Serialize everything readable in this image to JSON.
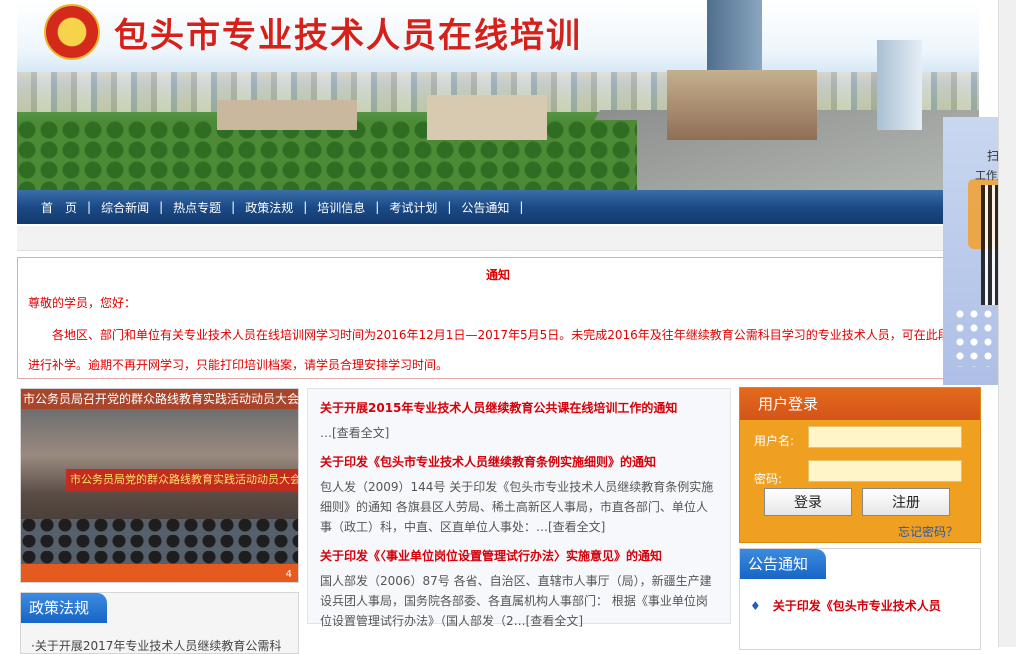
{
  "site": {
    "title": "包头市专业技术人员在线培训"
  },
  "nav": {
    "items": [
      "首　页",
      "综合新闻",
      "热点专题",
      "政策法规",
      "培训信息",
      "考试计划",
      "公告通知"
    ],
    "separator": "|"
  },
  "notice": {
    "title": "通知",
    "greeting": "尊敬的学员，您好：",
    "body": "各地区、部门和单位有关专业技术人员在线培训网学习时间为2016年12月1日—2017年5月5日。未完成2016年及往年继续教育公需科目学习的专业技术人员，可在此段内进行补学。逾期不再开网学习，只能打印培训档案，请学员合理安排学习时间。"
  },
  "photo": {
    "caption": "市公务员局召开党的群众路线教育实践活动动员大会",
    "stage_text": "市公务员局党的群众路线教育实践活动动员大会",
    "pager": "4"
  },
  "policy": {
    "heading": "政策法规",
    "first_item": "·关于开展2017年专业技术人员继续教育公需科"
  },
  "news": [
    {
      "title": "关于开展2015年专业技术人员继续教育公共课在线培训工作的通知",
      "desc": "…[查看全文]"
    },
    {
      "title": "关于印发《包头市专业技术人员继续教育条例实施细则》的通知",
      "desc": "包人发（2009）144号 关于印发《包头市专业技术人员继续教育条例实施细则》的通知 各旗县区人劳局、稀土高新区人事局，市直各部门、单位人事（政工）科，中直、区直单位人事处：…[查看全文]"
    },
    {
      "title": "关于印发《〈事业单位岗位设置管理试行办法〉实施意见》的通知",
      "desc": "国人部发（2006）87号 各省、自治区、直辖市人事厅（局），新疆生产建设兵团人事局，国务院各部委、各直属机构人事部门： 根据《事业单位岗位设置管理试行办法》（国人部发（2…[查看全文]"
    }
  ],
  "login": {
    "heading": "用户登录",
    "username_label": "用户名:",
    "password_label": "密码:",
    "login_button": "登录",
    "register_button": "注册",
    "forgot_link": "忘记密码？"
  },
  "announcements": {
    "heading": "公告通知",
    "items": [
      "关于印发《包头市专业技术人员"
    ]
  },
  "qr": {
    "line1": "扫一",
    "line2": "工作用"
  }
}
